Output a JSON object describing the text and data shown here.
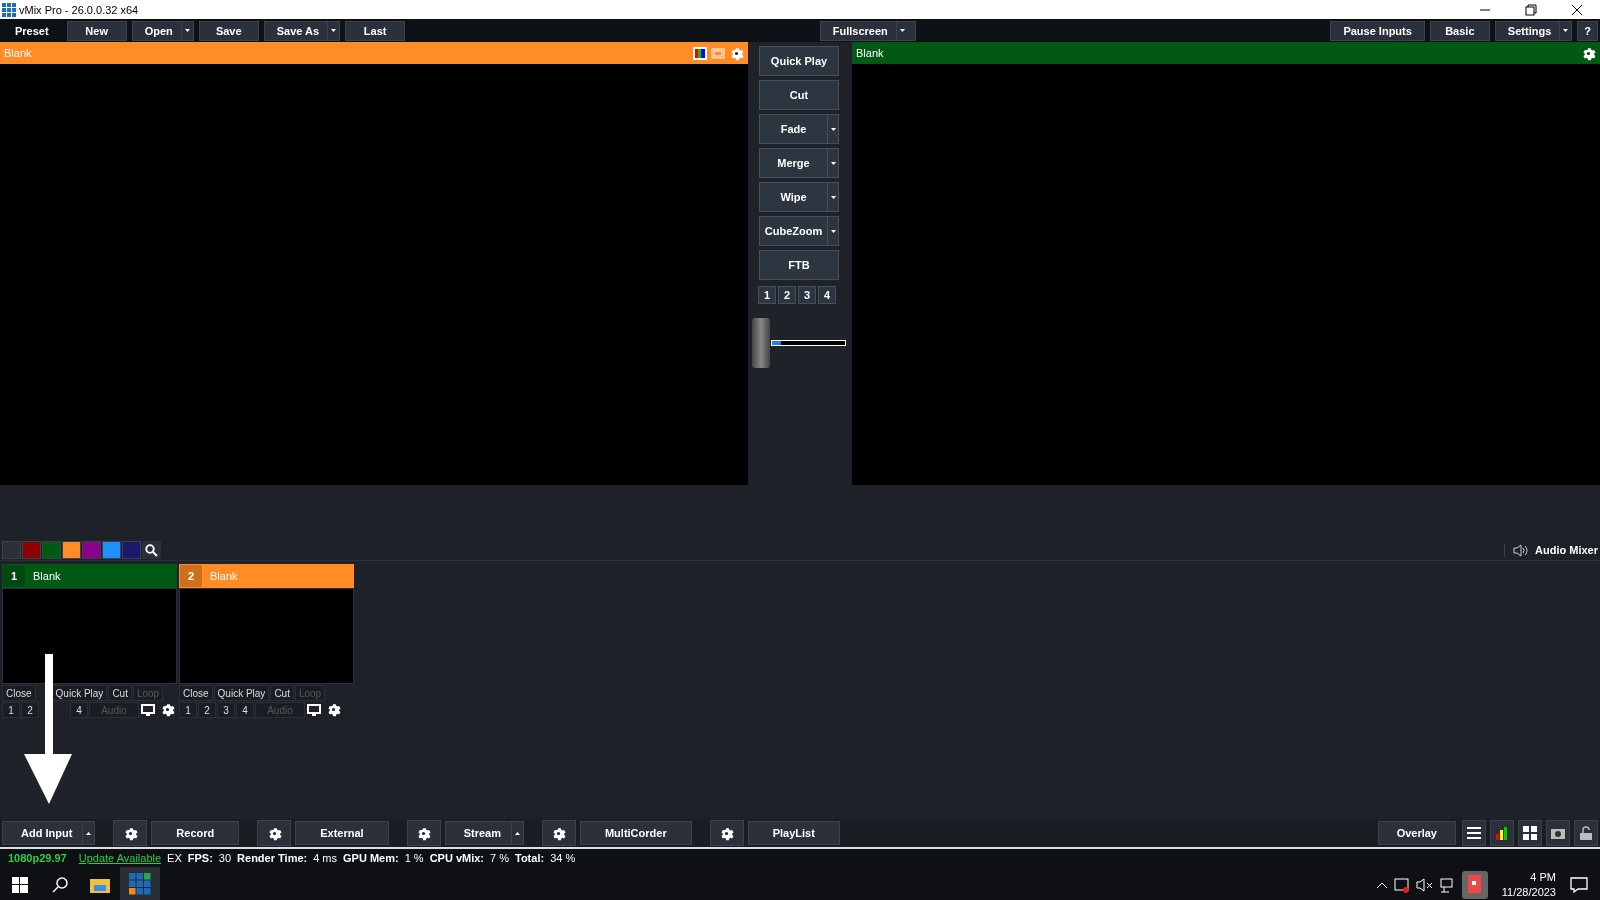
{
  "window": {
    "title": "vMix Pro - 26.0.0.32 x64"
  },
  "menu_left": [
    {
      "label": "Preset",
      "kind": "tab"
    },
    {
      "label": "New",
      "kind": "button"
    },
    {
      "label": "Open",
      "kind": "dropdown"
    },
    {
      "label": "Save",
      "kind": "button"
    },
    {
      "label": "Save As",
      "kind": "dropdown"
    },
    {
      "label": "Last",
      "kind": "button"
    }
  ],
  "menu_center": {
    "label": "Fullscreen"
  },
  "menu_right": [
    {
      "label": "Pause Inputs",
      "kind": "button"
    },
    {
      "label": "Basic",
      "kind": "button"
    },
    {
      "label": "Settings",
      "kind": "dropdown"
    },
    {
      "label": "?",
      "kind": "button"
    }
  ],
  "preview": {
    "title": "Blank",
    "color": "#ff8c26"
  },
  "output": {
    "title": "Blank",
    "color": "#005a13"
  },
  "transitions": [
    {
      "label": "Quick Play",
      "dropdown": false
    },
    {
      "label": "Cut",
      "dropdown": false
    },
    {
      "label": "Fade",
      "dropdown": true
    },
    {
      "label": "Merge",
      "dropdown": true
    },
    {
      "label": "Wipe",
      "dropdown": true
    },
    {
      "label": "CubeZoom",
      "dropdown": true
    },
    {
      "label": "FTB",
      "dropdown": false
    }
  ],
  "transition_numbers": [
    "1",
    "2",
    "3",
    "4"
  ],
  "tbar": {
    "level": 0.12
  },
  "color_filters": [
    {
      "color": "#2a2f38"
    },
    {
      "color": "#8b0000"
    },
    {
      "color": "#005a13"
    },
    {
      "color": "#ff8c26"
    },
    {
      "color": "#8b008b"
    },
    {
      "color": "#1e90ff"
    },
    {
      "color": "#191970"
    }
  ],
  "audio_mixer": {
    "label": "Audio Mixer"
  },
  "inputs": [
    {
      "number": "1",
      "title": "Blank",
      "color": "#005a13",
      "actions": [
        {
          "label": "Close",
          "disabled": false
        },
        {
          "label": "Quick Play",
          "disabled": false
        },
        {
          "label": "Cut",
          "disabled": false
        },
        {
          "label": "Loop",
          "disabled": true
        }
      ],
      "numbers": [
        "1",
        "2",
        "4"
      ],
      "audio": {
        "label": "Audio",
        "disabled": true
      }
    },
    {
      "number": "2",
      "title": "Blank",
      "color": "#ff8c26",
      "actions": [
        {
          "label": "Close",
          "disabled": false
        },
        {
          "label": "Quick Play",
          "disabled": false
        },
        {
          "label": "Cut",
          "disabled": false
        },
        {
          "label": "Loop",
          "disabled": true
        }
      ],
      "numbers": [
        "1",
        "2",
        "3",
        "4"
      ],
      "audio": {
        "label": "Audio",
        "disabled": true
      }
    }
  ],
  "bottom_bar": [
    {
      "label": "Add Input",
      "kind": "dropdown"
    },
    {
      "label": "Record",
      "kind": "settings"
    },
    {
      "label": "External",
      "kind": "settings"
    },
    {
      "label": "Stream",
      "kind": "settings-dropdown"
    },
    {
      "label": "MultiCorder",
      "kind": "settings"
    },
    {
      "label": "PlayList",
      "kind": "settings"
    }
  ],
  "overlay": {
    "label": "Overlay"
  },
  "status_bar": {
    "format": "1080p29.97",
    "update_link": "Update Available",
    "mode": "EX",
    "stats": [
      {
        "label": "FPS:",
        "value": "30"
      },
      {
        "label": "Render Time:",
        "value": "4 ms"
      },
      {
        "label": "GPU Mem:",
        "value": "1 %"
      },
      {
        "label": "CPU vMix:",
        "value": "7 %"
      },
      {
        "label": "Total:",
        "value": "34 %"
      }
    ]
  },
  "taskbar": {
    "time": "4 PM",
    "date": "11/28/2023"
  }
}
